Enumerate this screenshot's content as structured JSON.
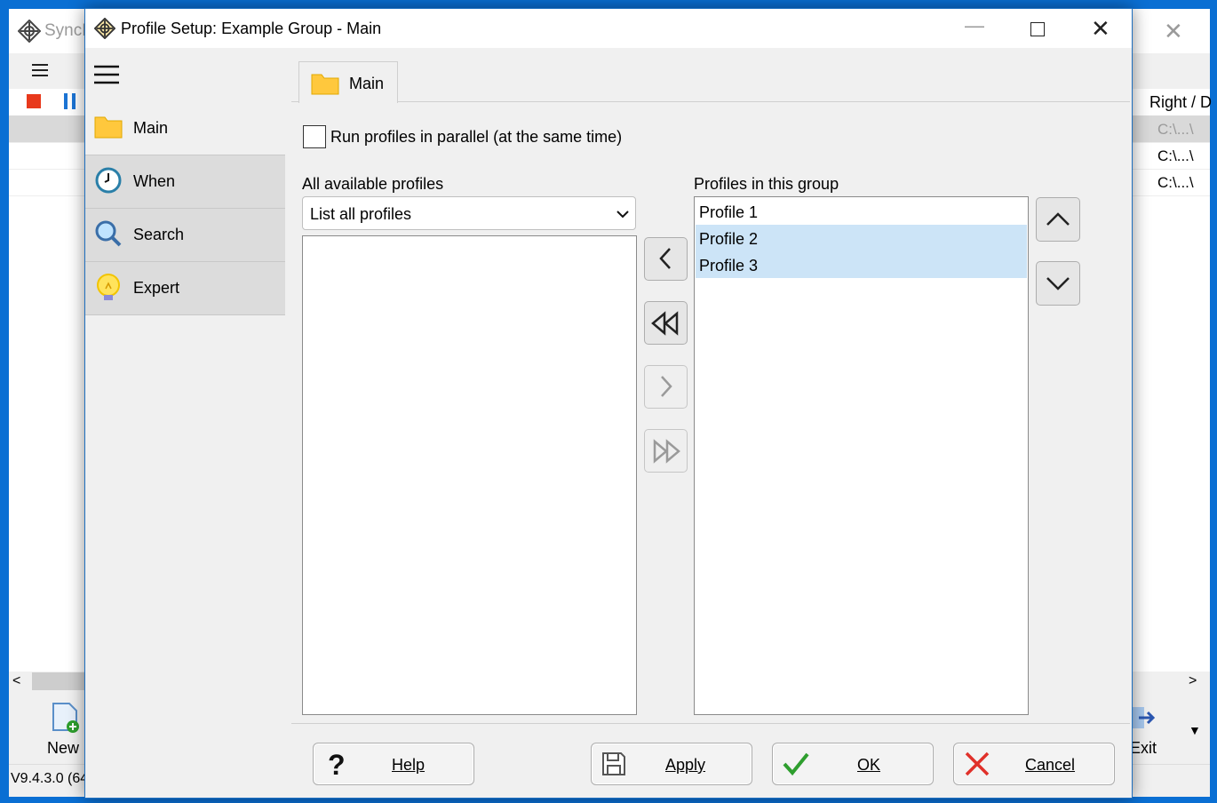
{
  "background_window": {
    "title": "SyncB",
    "column_header": "Right / D",
    "rows": [
      "C:\\...\\",
      "C:\\...\\",
      "C:\\...\\"
    ],
    "new_label": "New",
    "exit_label": "Exit",
    "version": "V9.4.3.0 (64"
  },
  "dialog": {
    "title": "Profile Setup: Example Group - Main",
    "nav": [
      {
        "label": "Main",
        "icon": "folder-icon"
      },
      {
        "label": "When",
        "icon": "clock-icon"
      },
      {
        "label": "Search",
        "icon": "magnifier-icon"
      },
      {
        "label": "Expert",
        "icon": "lightbulb-icon"
      }
    ],
    "tab": {
      "label": "Main",
      "icon": "folder-icon"
    },
    "checkbox": {
      "label": "Run profiles in parallel (at the same time)",
      "checked": false
    },
    "available": {
      "label": "All available profiles",
      "filter_value": "List all profiles",
      "items": []
    },
    "group": {
      "label": "Profiles in this group",
      "items": [
        {
          "name": "Profile 1",
          "selected": false
        },
        {
          "name": "Profile 2",
          "selected": true
        },
        {
          "name": "Profile 3",
          "selected": true
        }
      ]
    },
    "buttons": {
      "help": "Help",
      "apply": "Apply",
      "ok": "OK",
      "cancel": "Cancel"
    }
  },
  "colors": {
    "accent_selection": "#cce4f7",
    "desktop": "#0a6fd3",
    "ok_green": "#2e9e2e",
    "cancel_red": "#e0302a",
    "folder_yellow": "#ffc83d"
  }
}
